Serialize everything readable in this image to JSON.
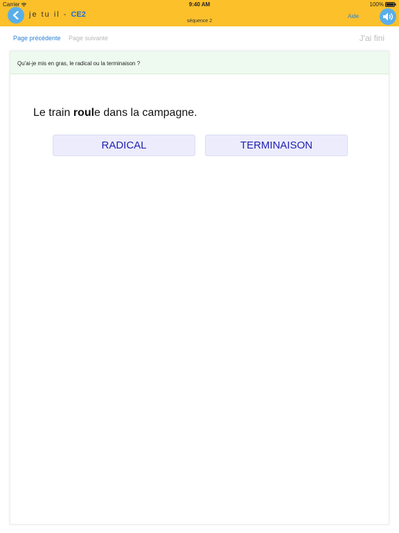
{
  "status_bar": {
    "carrier": "Carrier",
    "time": "9:40 AM",
    "battery": "100%"
  },
  "header": {
    "title_prefix": "je tu il - ",
    "title_level": "CE2",
    "sequence": "séquence 2",
    "help_label": "Aide",
    "back_icon": "chevron-left-icon",
    "sound_icon": "speaker-icon",
    "accent_color": "#fcc02b"
  },
  "page_nav": {
    "previous_label": "Page précédente",
    "next_label": "Page suivante",
    "done_label": "J'ai fini"
  },
  "exercise": {
    "instruction": "Qu'ai-je mis en gras, le radical ou la terminaison ?",
    "sentence_before": "Le train ",
    "sentence_bold": "roul",
    "sentence_after": "e dans la campagne.",
    "answers": [
      "RADICAL",
      "TERMINAISON"
    ]
  }
}
